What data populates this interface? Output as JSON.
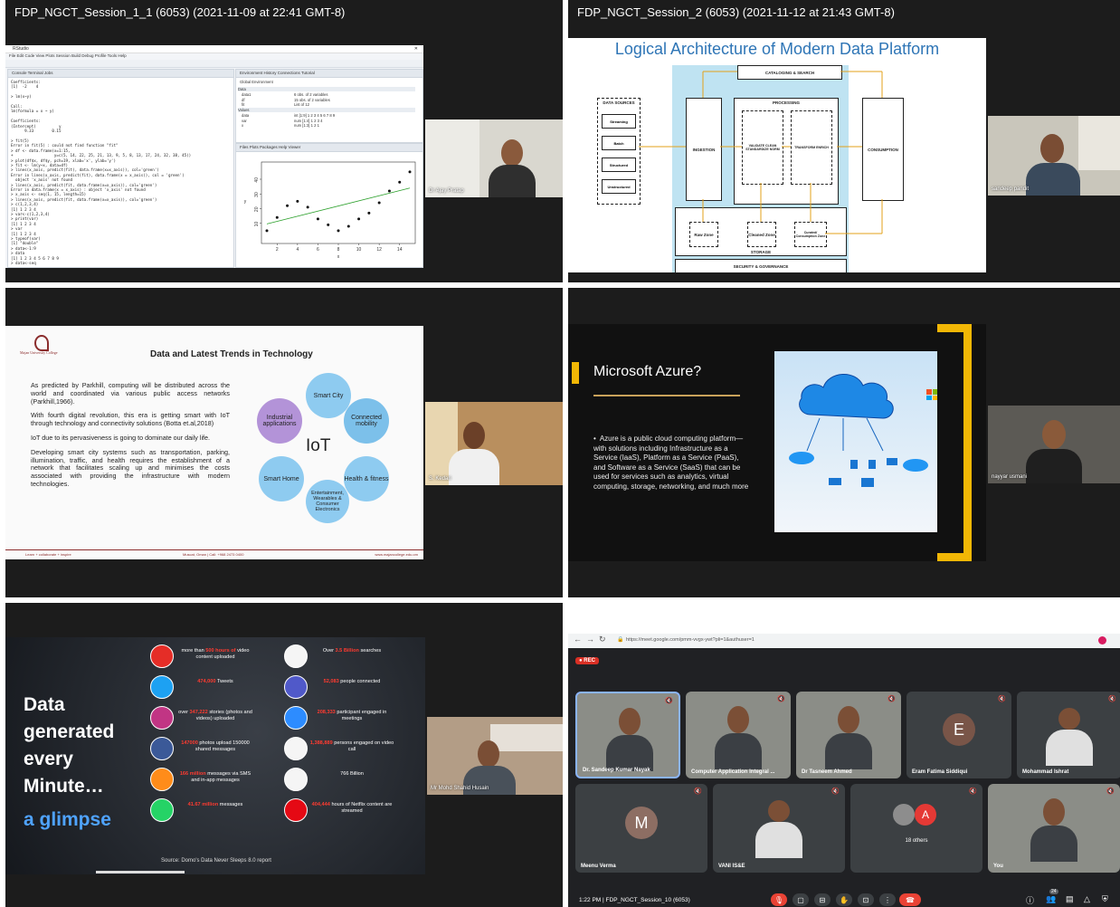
{
  "tiles": {
    "t1_title": "FDP_NGCT_Session_1_1 (6053) (2021-11-09 at 22:41 GMT-8)",
    "t2_title": "FDP_NGCT_Session_2 (6053) (2021-11-12 at 21:43 GMT-8)"
  },
  "rstudio": {
    "app": "RStudio",
    "menu": "File  Edit  Code  View  Plots  Session  Build  Debug  Profile  Tools  Help",
    "console_tabs": "Console   Terminal   Jobs",
    "env_tabs": "Environment   History   Connections   Tutorial",
    "files_tabs": "Files   Plots   Packages   Help   Viewer",
    "console_code": "Coefficients:\n[1]  -2    4\n\n> lm(x~y)\n\nCall:\nlm(formula = x ~ y)\n\nCoefficients:\n(Intercept)          y\n      9.33        0.15\n\n> fit(5)\nError in fit(5) : could not find function \"fit\"\n> df <- data.frame(x=1:15,\n+                  y=c(5, 14, 22, 25, 21, 13, 9, 5, 8, 13, 17, 24, 32, 38, 45))\n> plot(df$x, df$y, pch=19, xlab='x', ylab='y')\n> fit <- lm(y~x, data=df)\n> lines(x_axis, predict(fit), data.frame(x=x_axis)), col='green')\nError in lines(x_axis, predict(fit), data.frame(x = x_axis)), col = 'green')\n  object 'x_axis' not found\n> lines(x_axis, predict(fit, data.frame(x=x_axis)), col='green')\nError in data.frame(x = x_axis) : object 'x_axis' not found\n> x_axis <- seq(1, 15, length=15)\n> lines(x_axis, predict(fit, data.frame(x=x_axis)), col='green')\n> c(1,2,3,4)\n[1] 1 2 3 4\n> var<-c(1,2,3,4)\n> print(var)\n[1] 1 2 3 4\n> var\n[1] 1 2 3 4\n> typeof(var)\n[1] \"double\"\n> data<-1:9\n> data\n[1] 1 2 3 4 5 6 7 8 9\n> data<-seq",
    "env_header": "Global Environment",
    "env_data_label": "Data",
    "env_rows": [
      {
        "name": "data1",
        "value": "6 obs. of 2 variables"
      },
      {
        "name": "df",
        "value": "15 obs. of 2 variables"
      },
      {
        "name": "fit",
        "value": "List of 12"
      }
    ],
    "env_values_label": "Values",
    "env_values": [
      {
        "name": "data",
        "value": "int [1:9] 1 2 3 4 5 6 7 8 9"
      },
      {
        "name": "var",
        "value": "num [1:4] 1 2 3 4"
      },
      {
        "name": "x",
        "value": "num [1:3] 1 2 1"
      }
    ],
    "plot": {
      "x_ticks": [
        "2",
        "4",
        "6",
        "8",
        "10",
        "12",
        "14"
      ],
      "y_ticks": [
        "10",
        "20",
        "30",
        "40"
      ],
      "xlabel": "x",
      "ylabel": "y"
    },
    "speaker": "Dr Ajay Pratap"
  },
  "diagram": {
    "title": "Logical Architecture of Modern Data Platform",
    "catalog": "CATALOGING & SEARCH",
    "processing": "PROCESSING",
    "data_sources": "DATA SOURCES",
    "sources": [
      "Streaming",
      "Batch",
      "Structured",
      "Unstructured"
    ],
    "ingestion": "INGESTION",
    "validate": "VALIDATE CLEAN STANDARDIZE NORM",
    "transform": "TRANSFORM ENRICH",
    "consumption": "CONSUMPTION",
    "raw": "Raw Zone",
    "cleaned": "Cleaned Zone",
    "curated": "Curated/ Consumption Zone",
    "storage": "STORAGE",
    "security": "SECURITY & GOVERNANCE",
    "speaker": "sandeep pandit"
  },
  "iot": {
    "college": "Majan University College",
    "title": "Data and Latest Trends in Technology",
    "paragraphs": [
      "As predicted by Parkhill, computing will be distributed across the world and coordinated via various public access networks (Parkhill,1966).",
      "With fourth digital revolution, this era is getting smart with IoT through technology and connectivity solutions (Botta et.al,2018)",
      "IoT due to its pervasiveness is going to dominate our daily life.",
      "Developing smart city systems such as transportation, parking, illumination, traffic, and health requires the establishment of a network that facilitates scaling up and minimises the costs associated with providing the infrastructure with modern technologies."
    ],
    "center": "IoT",
    "petals": [
      "Smart City",
      "Connected mobility",
      "Health & fitness",
      "Entertainment, Wearables & Consumer Electronics",
      "Smart Home",
      "Industrial applications"
    ],
    "footer_left": "Learn + collaborate + inspire",
    "footer_mid": "Muscat, Oman | Call: +968 2473 0400",
    "footer_right": "www.majancollege.edu.om",
    "speaker": "S. Kedari"
  },
  "azure": {
    "title": "Microsoft Azure?",
    "bullet": "Azure is a public cloud computing platform—with solutions including Infrastructure as a Service (IaaS), Platform as a Service (PaaS), and Software as a Service (SaaS) that can be used for services such as analytics, virtual computing, storage, networking, and much more",
    "ms_text": "Mi",
    "speaker": "nayyar usmani"
  },
  "data_minute": {
    "heading_lines": [
      "Data",
      "generated",
      "every",
      "Minute…"
    ],
    "glimpse": "a glimpse",
    "stats_left": [
      {
        "pre": "more than ",
        "num": "500 hours of",
        "post": " video content uploaded",
        "icon": "youtube-icon",
        "color": "#e52d27"
      },
      {
        "pre": "",
        "num": "474,000",
        "post": " Tweets",
        "icon": "twitter-icon",
        "color": "#1da1f2"
      },
      {
        "pre": "over ",
        "num": "347,222",
        "post": " stories (photos and videos) uploaded",
        "icon": "instagram-icon",
        "color": "#c13584"
      },
      {
        "pre": "",
        "num": "147000",
        "post": " photos upload 150000 shared messages",
        "icon": "facebook-icon",
        "color": "#3b5998"
      },
      {
        "pre": "",
        "num": "166 million",
        "post": " messages via SMS and in-app messages",
        "icon": "sms-icon",
        "color": "#ff8c1a"
      },
      {
        "pre": "",
        "num": "41.67 million",
        "post": " messages",
        "icon": "whatsapp-icon",
        "color": "#25d366"
      }
    ],
    "stats_right": [
      {
        "pre": "Over ",
        "num": "3.5 Billion",
        "post": " searches",
        "icon": "google-icon",
        "color": "#ffffff"
      },
      {
        "pre": "",
        "num": "52,083",
        "post": " people connected",
        "icon": "teams-icon",
        "color": "#5059c9"
      },
      {
        "pre": "",
        "num": "208,333",
        "post": " participant engaged in meetings",
        "icon": "zoom-icon",
        "color": "#2d8cff"
      },
      {
        "pre": "",
        "num": "1,388,889",
        "post": " persons engaged on video call",
        "icon": "videocall-icon",
        "color": "#ffffff"
      },
      {
        "pre": "",
        "num": "",
        "post": "766 Billion",
        "icon": "email-icon",
        "color": "#ffffff"
      },
      {
        "pre": "",
        "num": "404,444",
        "post": " hours of Netflix content are streamed",
        "icon": "netflix-icon",
        "color": "#e50914"
      }
    ],
    "source": "Source: Domo's Data Never Sleeps 8.0 report",
    "speaker": "Mr Mohd Shahid Husain"
  },
  "meet": {
    "url": "https://meet.google.com/pmm-vvgx-ywt?pli=1&authuser=1",
    "rec": "REC",
    "participants_row1": [
      {
        "name": "Dr. Sandeep Kumar Nayak",
        "type": "video"
      },
      {
        "name": "Computer Application Integral ...",
        "type": "video"
      },
      {
        "name": "Dr Tasneem Ahmed",
        "type": "video"
      },
      {
        "name": "Eram Fatima Siddiqui",
        "type": "avatar",
        "letter": "E",
        "color": "#795548"
      },
      {
        "name": "Mohammad Ishrat",
        "type": "photo"
      }
    ],
    "participants_row2": [
      {
        "name": "Meenu Verma",
        "type": "avatar",
        "letter": "M",
        "color": "#8d6e63"
      },
      {
        "name": "VANI IS&E",
        "type": "photo"
      },
      {
        "name": "18 others",
        "type": "others",
        "letter": "A"
      },
      {
        "name": "You",
        "type": "video"
      }
    ],
    "time": "1:22 PM",
    "meeting": "FDP_NGCT_Session_10 (6053)",
    "people_count": "24"
  }
}
